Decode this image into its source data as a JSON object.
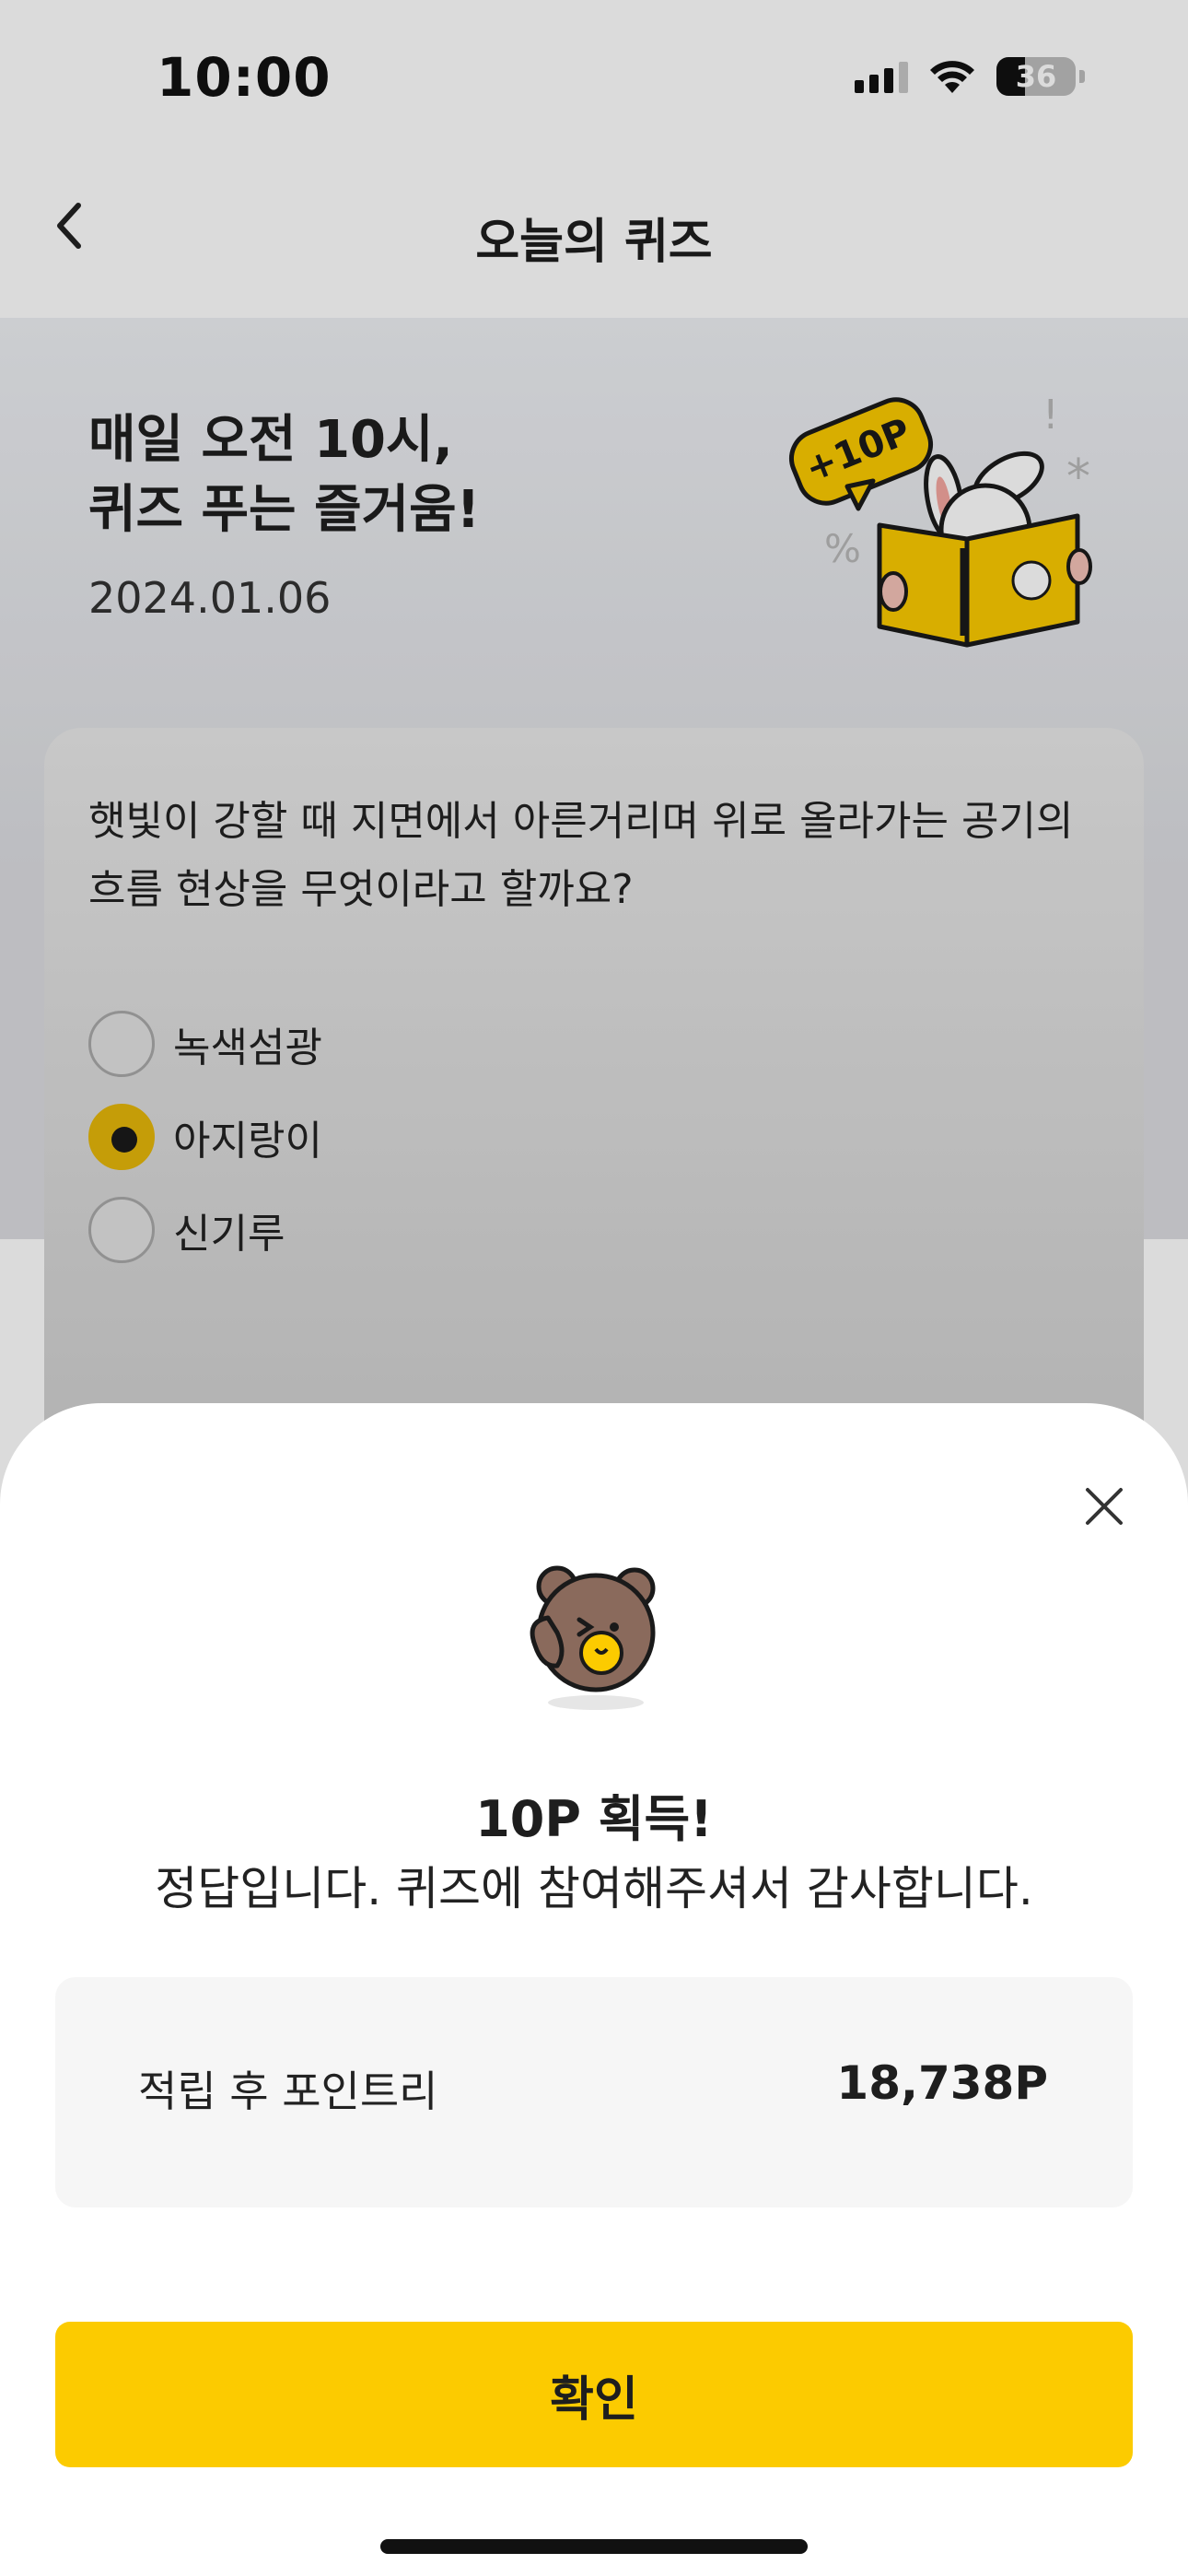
{
  "status_bar": {
    "time": "10:00",
    "battery_level": "36",
    "icons": [
      "cellular-signal-icon",
      "wifi-icon",
      "battery-icon"
    ]
  },
  "header": {
    "title": "오늘의 퀴즈",
    "back_icon": "chevron-left-icon"
  },
  "hero": {
    "title_line1": "매일 오전 10시,",
    "title_line2": "퀴즈 푸는 즐거움!",
    "date": "2024.01.06",
    "badge": "+10P"
  },
  "quiz": {
    "question_line1": "햇빛이 강할 때 지면에서 아른거리며 위로 올라가는 공기의",
    "question_line2": "흐름 현상을 무엇이라고 할까요?",
    "options": [
      {
        "label": "녹색섬광",
        "selected": false
      },
      {
        "label": "아지랑이",
        "selected": true
      },
      {
        "label": "신기루",
        "selected": false
      }
    ]
  },
  "result_sheet": {
    "close_icon": "close-icon",
    "reward_title": "10P 획득!",
    "reward_message": "정답입니다. 퀴즈에 참여해주셔서 감사합니다.",
    "points_label": "적립 후 포인트리",
    "points_value": "18,738P",
    "confirm_label": "확인"
  },
  "colors": {
    "accent": "#fccb00",
    "radio_selected": "#e6b70a",
    "text_primary": "#1e1e1e"
  }
}
